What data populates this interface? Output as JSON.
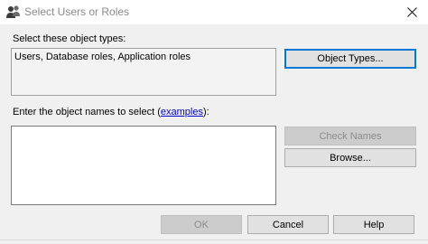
{
  "window": {
    "title": "Select Users or Roles",
    "icon": "users-icon",
    "close_glyph": "✕"
  },
  "object_types": {
    "label": "Select these object types:",
    "value": "Users, Database roles, Application roles",
    "button_label": "Object Types..."
  },
  "object_names": {
    "label_prefix": "Enter the object names to select (",
    "link_text": "examples",
    "label_suffix": "):",
    "value": "",
    "check_names_label": "Check Names",
    "browse_label": "Browse..."
  },
  "footer": {
    "ok_label": "OK",
    "cancel_label": "Cancel",
    "help_label": "Help"
  },
  "colors": {
    "link": "#0000cc",
    "focus_border": "#0078d7"
  }
}
